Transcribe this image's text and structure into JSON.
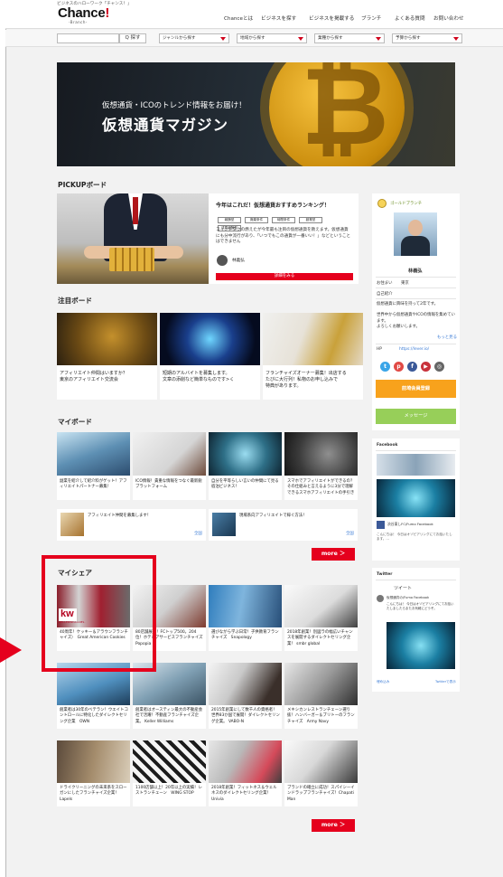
{
  "header": {
    "tagline": "ビジネスのハローワーク「チャンス！」",
    "logo_main": "Chance",
    "logo_mark": "!",
    "logo_sub": "-Branch-",
    "nav": [
      "Chanceとは",
      "ビジネスを探す",
      "ビジネスを掲載する",
      "ブランチ",
      "よくある質問",
      "お問い合わせ"
    ]
  },
  "search": {
    "button": "Q 探す",
    "selects": [
      "ジャンルから探す",
      "地域から探す",
      "業種から探す",
      "予算から探す"
    ]
  },
  "banner": {
    "subtitle": "仮想通貨・ICOのトレンド情報をお届け！",
    "title": "仮想通貨マガジン"
  },
  "pickup": {
    "section_title": "PICKUPボード",
    "title": "今年はこれだ！仮想通貨おすすめランキング！",
    "tags": [
      "報酬型",
      "廃棄条件",
      "時間条件",
      "副業型",
      "成果報酬型"
    ],
    "description": "コインチタクの燃えたが今年最も注目の仮想通貨を教えます。仮想通貨にも分中流行があり、「いつでもこの通貨が一番いい！」などということはできません",
    "user": "林義弘",
    "button": "詳細をみる"
  },
  "featured": {
    "section_title": "注目ボード",
    "cards": [
      {
        "text": "アフィリエイト仲間はいますか？\n東京のアフィリエイト交流会"
      },
      {
        "text": "短期のアルバイトを募集します。\n文章の添削など簡単なものです>く"
      },
      {
        "text": "フランチャイズオーナー募集！出店する\nたびに大行列！私物のお申し込みで\n特典があります。"
      }
    ]
  },
  "myboard": {
    "section_title": "マイボード",
    "cards": [
      {
        "text": "副業を紹介して紹介料がゲット！アフィリエイトパートナー募集！"
      },
      {
        "text": "ICO情報！貴重な情報をつなぐ最新鋭ブラットフォーム"
      },
      {
        "text": "自分を平等らしい言いの仲間にて見る宿泊ビジネス！"
      },
      {
        "text": "スマホでアフィリエイトができるの？その仕組みと言えるように3分で理解できるスマホアフィリエイトの手引き"
      }
    ],
    "wide": [
      {
        "text": "アフィリエイト仲間を募集します！",
        "link": "全国"
      },
      {
        "text": "現場系向アフィリエイトで稼ぐ方法！",
        "link": "全国"
      }
    ],
    "more": "more ＞"
  },
  "myshare": {
    "section_title": "マイシェア",
    "logo_text": "kw",
    "logo_sub": "KELLERWILLIAMS.",
    "cards": [
      {
        "text": "40周年！ケッキー＆アラウンフランチャイズ）　Great American Cookies"
      },
      {
        "text": "80店舗展開！FCトップ500。204位！ホテルアサービスフランチャイズ Popopia"
      },
      {
        "text": "選びながら学ぶ日常！子供教育フランチャイズ　Snapology"
      },
      {
        "text": "2018年創業！別図ラの幅広いチャンスを展開するダイレクトセリング企業！ smbr global"
      },
      {
        "text": "創業者は30年のベテラン！ウエイトコントロールに特化したダイレクトセリング企業　OWN"
      },
      {
        "text": "創業者はオースティン最大の不動産会社で活躍！不動産フランチャイズ企業。 Keller Williams"
      },
      {
        "text": "2015年創業にして数千人の資格者！世界83か国で展開！ダイレクトセリング企業。 VABO-N"
      },
      {
        "text": "メキシカンレストランチェーン選り抜！ハンバーガー＆ブリトーのフランチャイズ　Army Navy"
      },
      {
        "text": "ドライクリーニングの未来系をスローガンにしたフランチャイズ企業！　Lapels"
      },
      {
        "text": "1100店舗以上！20年以上の実績！レストランチェーン　WING STOP"
      },
      {
        "text": "2018年創業！フィットネス＆ウェルネスのダイレクトセリング企業！Univia"
      },
      {
        "text": "ブランドの確立に成功！スパイシーインドラップフランチャイズ！Chapati Man"
      }
    ],
    "more": "more ＞"
  },
  "sidebar": {
    "profile": {
      "badge": "ゴールドブランチ",
      "name": "林義弘",
      "region_label": "お住まい",
      "region": "東京",
      "intro_label": "自己紹介",
      "intro": "仮想通貨に興味を持って2年です。\n\n世界中から仮想通貨やICOの情報を集めています。\nよろしくお願いします。",
      "read_more": "もっと見る",
      "hp_label": "HP",
      "hp": "https://lever.io/",
      "follow": "お気に入り登録",
      "message": "メッセージ",
      "btn_member": "前埼会員登録"
    },
    "facebook": {
      "title": "Facebook",
      "page": "渋谷東しFC/Fumo Facebook",
      "post": "こんにちは！ 今日はオゾピアリングにてお話いたします。..."
    },
    "twitter": {
      "title": "Twitter",
      "tweets_label": "ツイート",
      "user": "仮想通貨の/Fumo Facebook",
      "text": "こんにちは！ 今日はオゾピアリングにてお話いたしましたらまたお気軽にどうぞ。",
      "footer_left": "埋め込み",
      "footer_right": "Twitterで表示"
    }
  }
}
